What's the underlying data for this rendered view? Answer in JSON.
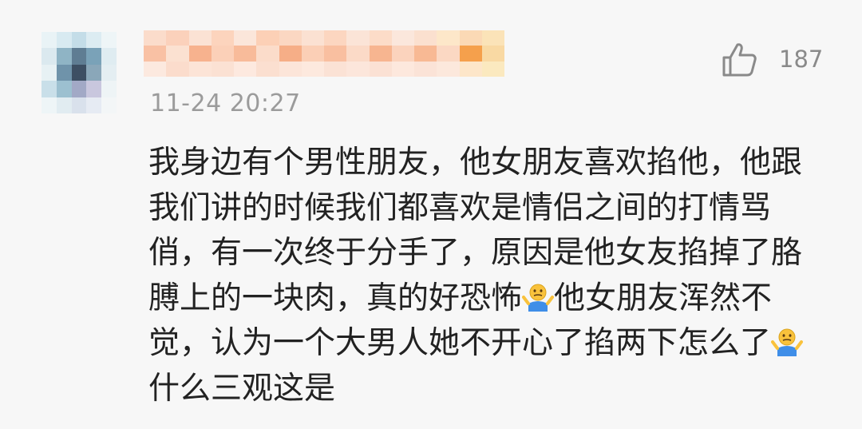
{
  "comment": {
    "timestamp": "11-24 20:27",
    "like_count": "187",
    "text_segments": [
      "我身边有个男性朋友，他女朋友喜欢掐他，他跟我们讲的时候我们都喜欢是情侣之间的打情骂俏，有一次终于分手了，原因是他女友掐掉了胳膊上的一块肉，真的好恐怖",
      "他女朋友浑然不觉，认为一个大男人她不开心了掐两下怎么了",
      "什么三观这是"
    ],
    "inline_emoji": "shrug-emoji",
    "like_icon": "thumbs-up-icon",
    "avatar_blurred": true,
    "username_blurred": true
  },
  "colors": {
    "background": "#f7f7f7",
    "text": "#222222",
    "meta_text": "#9b9b9b",
    "username_mosaic": "#fbc9a8"
  }
}
